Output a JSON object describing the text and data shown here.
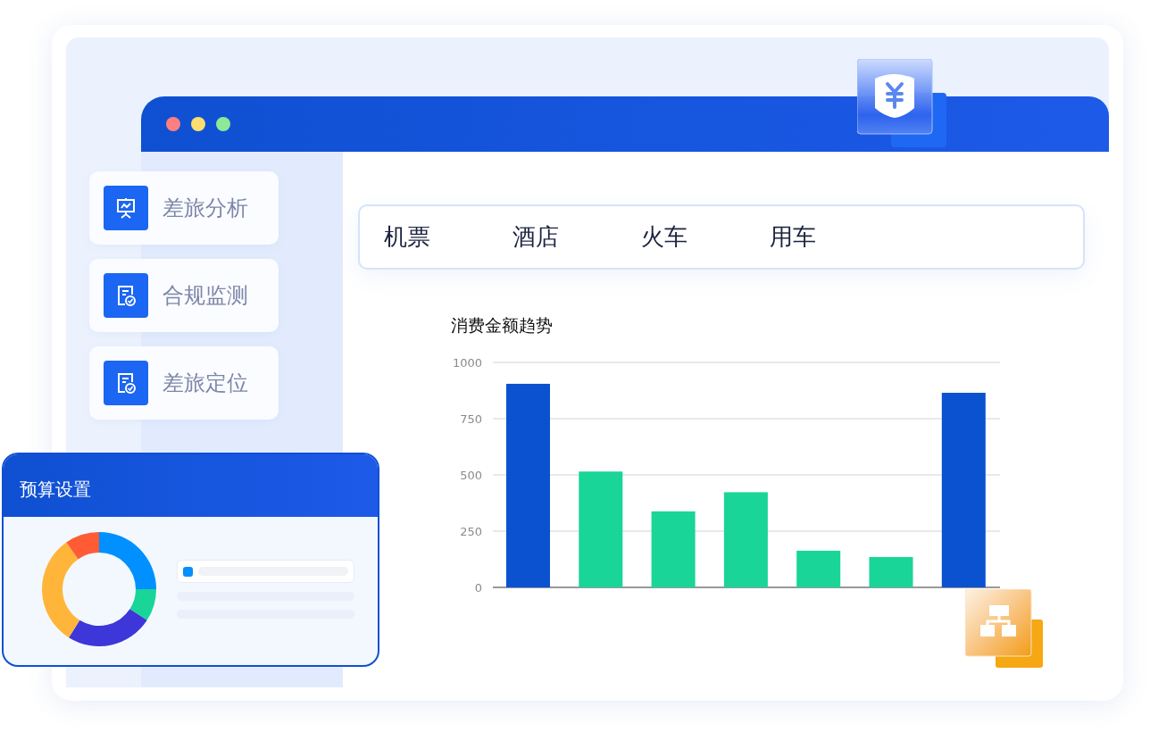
{
  "sidebar": {
    "items": [
      {
        "label": "差旅分析"
      },
      {
        "label": "合规监测"
      },
      {
        "label": "差旅定位"
      }
    ]
  },
  "tabs": [
    {
      "label": "机票"
    },
    {
      "label": "酒店"
    },
    {
      "label": "火车"
    },
    {
      "label": "用车"
    }
  ],
  "chart": {
    "title": "消费金额趋势",
    "chart_data": {
      "type": "bar",
      "stacked": true,
      "grid": true,
      "ylim": [
        0,
        1000
      ],
      "yticks": [
        0,
        250,
        500,
        750,
        1000
      ],
      "series": [
        {
          "color": "#0b52d0",
          "values": [
            905,
            null,
            null,
            null,
            null,
            null,
            865
          ]
        },
        {
          "color": "#1ad598",
          "values": [
            null,
            515,
            338,
            423,
            163,
            135,
            null
          ]
        }
      ]
    }
  },
  "budget_card": {
    "title": "预算设置"
  }
}
